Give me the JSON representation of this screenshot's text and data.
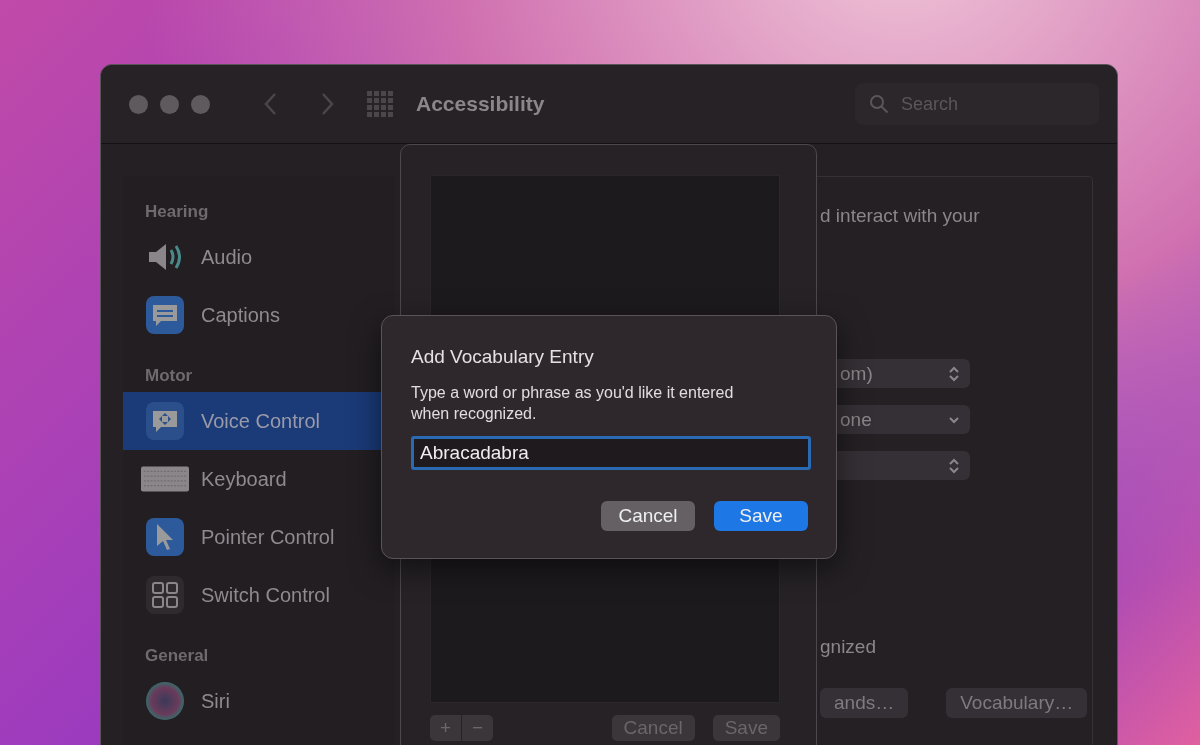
{
  "window": {
    "title": "Accessibility",
    "search": {
      "placeholder": "Search"
    }
  },
  "sidebar": {
    "sections": [
      {
        "heading": "Hearing",
        "items": [
          {
            "label": "Audio",
            "kind": "audio",
            "selected": false
          },
          {
            "label": "Captions",
            "kind": "captions",
            "selected": false
          }
        ]
      },
      {
        "heading": "Motor",
        "items": [
          {
            "label": "Voice Control",
            "kind": "voice",
            "selected": true
          },
          {
            "label": "Keyboard",
            "kind": "keyboard",
            "selected": false
          },
          {
            "label": "Pointer Control",
            "kind": "pointer",
            "selected": false
          },
          {
            "label": "Switch Control",
            "kind": "switch",
            "selected": false
          }
        ]
      },
      {
        "heading": "General",
        "items": [
          {
            "label": "Siri",
            "kind": "siri",
            "selected": false
          }
        ]
      }
    ]
  },
  "main_pane": {
    "description": "d interact with your",
    "popups": [
      {
        "value": "om)",
        "kind": "stepper"
      },
      {
        "value": "one",
        "kind": "dropdown"
      },
      {
        "kind": "stepper"
      }
    ],
    "text_2": "gnized",
    "buttons": [
      "ands…",
      "Vocabulary…"
    ]
  },
  "vocabulary_sheet": {
    "add_button": "+",
    "remove_button": "−",
    "buttons": [
      "Cancel",
      "Save"
    ]
  },
  "dialog": {
    "title": "Add Vocabulary Entry",
    "message": "Type a word or phrase as you'd like it entered when recognized.",
    "field": {
      "value": "Abracadabra",
      "focused": true
    },
    "buttons": [
      {
        "label": "Cancel",
        "kind": "secondary"
      },
      {
        "label": "Save",
        "kind": "primary"
      }
    ]
  }
}
